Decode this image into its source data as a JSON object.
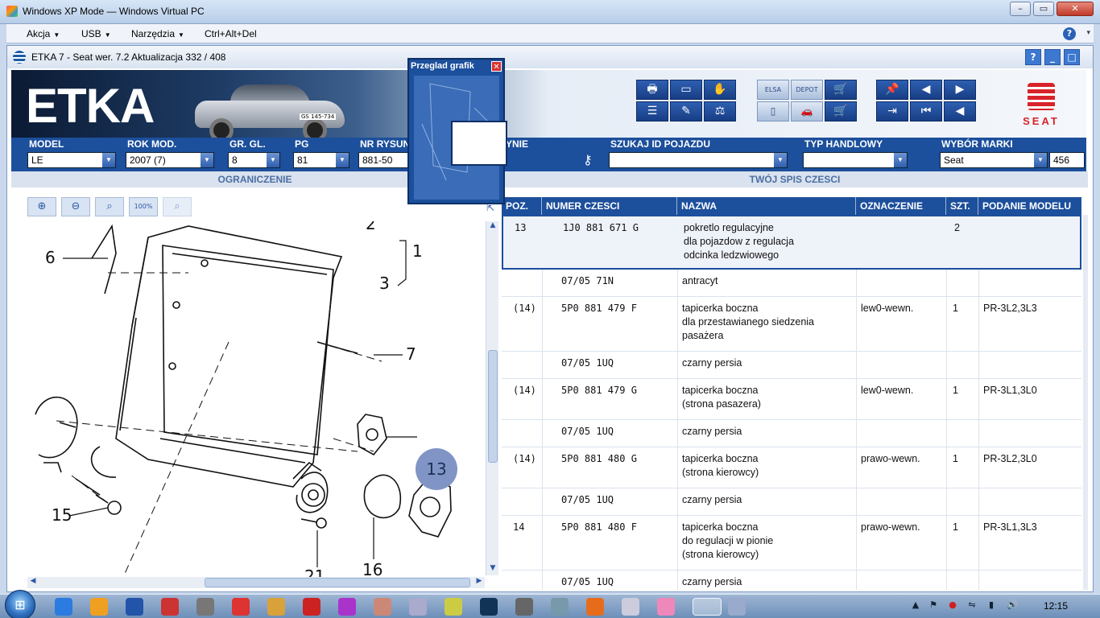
{
  "host": {
    "title": "Windows XP Mode — Windows Virtual PC",
    "menu": [
      "Akcja",
      "USB",
      "Narzędzia",
      "Ctrl+Alt+Del"
    ]
  },
  "etka": {
    "title": "ETKA 7 - Seat wer. 7.2 Aktualizacja 332 / 408",
    "logo": "ETKA",
    "brand_word": "SEAT",
    "car_plate": "GS 145-734",
    "colors": {
      "primary": "#1c4f9c",
      "seat_red": "#d8232a",
      "callout": "#8095c6"
    }
  },
  "toolbar_icons": [
    "printer-icon",
    "window-icon",
    "handshake-icon",
    "list-icon",
    "pencil-icon",
    "scale-icon",
    "elsa-icon",
    "depot-icon",
    "cart-add-icon",
    "monitor-icon",
    "car-service-icon",
    "cart-icon",
    "pin-icon",
    "prev-page-icon",
    "next-page-icon",
    "exit-icon",
    "first-icon",
    "back-icon"
  ],
  "toolbar_labels": {
    "elsa": "ELSA",
    "depot": "DEPOT"
  },
  "selectors": {
    "model_label": "MODEL",
    "model_value": "LE",
    "rok_label": "ROK MOD.",
    "rok_value": "2007 (7)",
    "gr_label": "GR. GL.",
    "gr_value": "8",
    "pg_label": "PG",
    "pg_value": "81",
    "nr_label": "NR RYSUNKU",
    "nr_value": "881-50",
    "yfragment_label": "YNIE",
    "szukaj_label": "SZUKAJ ID POJAZDU",
    "szukaj_value": "",
    "typ_label": "TYP HANDLOWY",
    "typ_value": "",
    "marka_label": "WYBÓR MARKI",
    "marka_value": "Seat",
    "marka_extra": "456"
  },
  "sections": {
    "left": "OGRANICZENIE",
    "right": "TWÓJ SPIS CZESCI"
  },
  "zoom_buttons": [
    "zoom-in-icon",
    "zoom-out-icon",
    "zoom-area-icon",
    "zoom-100-icon",
    "zoom-fit-icon"
  ],
  "zoom_100_label": "100%",
  "drawing": {
    "labels": [
      "6",
      "2",
      "1",
      "3",
      "7",
      "13",
      "15",
      "21",
      "16"
    ]
  },
  "popup": {
    "title": "Przeglad grafik"
  },
  "table": {
    "headers": [
      "POZ.",
      "NUMER CZESCI",
      "NAZWA",
      "OZNACZENIE",
      "SZT.",
      "PODANIE MODELU"
    ],
    "rows": [
      {
        "poz": "13",
        "numer": "1J0  881  671  G",
        "nazwa": "pokretlo regulacyjne\ndla pojazdow z regulacja\nodcinka ledzwiowego",
        "ozn": "",
        "szt": "2",
        "model": ""
      },
      {
        "poz": "",
        "numer": "07/05          71N",
        "nazwa": "antracyt",
        "ozn": "",
        "szt": "",
        "model": ""
      },
      {
        "poz": "(14)",
        "numer": "5P0  881  479  F",
        "nazwa": "tapicerka boczna\ndla przestawianego siedzenia\npasażera",
        "ozn": "lew0-wewn.",
        "szt": "1",
        "model": "PR-3L2,3L3"
      },
      {
        "poz": "",
        "numer": "07/05          1UQ",
        "nazwa": "czarny persia",
        "ozn": "",
        "szt": "",
        "model": ""
      },
      {
        "poz": "(14)",
        "numer": "5P0  881  479  G",
        "nazwa": "tapicerka boczna\n(strona pasazera)",
        "ozn": "lew0-wewn.",
        "szt": "1",
        "model": "PR-3L1,3L0"
      },
      {
        "poz": "",
        "numer": "07/05          1UQ",
        "nazwa": "czarny persia",
        "ozn": "",
        "szt": "",
        "model": ""
      },
      {
        "poz": "(14)",
        "numer": "5P0  881  480  G",
        "nazwa": "tapicerka boczna\n(strona kierowcy)",
        "ozn": "prawo-wewn.",
        "szt": "1",
        "model": "PR-3L2,3L0"
      },
      {
        "poz": "",
        "numer": "07/05          1UQ",
        "nazwa": "czarny persia",
        "ozn": "",
        "szt": "",
        "model": ""
      },
      {
        "poz": "14",
        "numer": "5P0  881  480  F",
        "nazwa": "tapicerka boczna\ndo regulacji w pionie\n(strona kierowcy)",
        "ozn": "prawo-wewn.",
        "szt": "1",
        "model": "PR-3L1,3L3"
      },
      {
        "poz": "",
        "numer": "07/05          1UQ",
        "nazwa": "czarny persia",
        "ozn": "",
        "szt": "",
        "model": ""
      }
    ]
  },
  "taskbar": {
    "apps": [
      "ie-icon",
      "media-icon",
      "shield-icon",
      "pin-icon",
      "clock-icon",
      "power-icon",
      "explorer-icon",
      "car-icon",
      "crab-icon",
      "paint-icon",
      "calc-icon",
      "cd-icon",
      "m-icon",
      "sound-icon",
      "grid-icon",
      "firefox-icon",
      "notes-icon",
      "smiley-icon",
      "xpmode-icon",
      "vpc-icon"
    ],
    "clock": "12:15"
  }
}
